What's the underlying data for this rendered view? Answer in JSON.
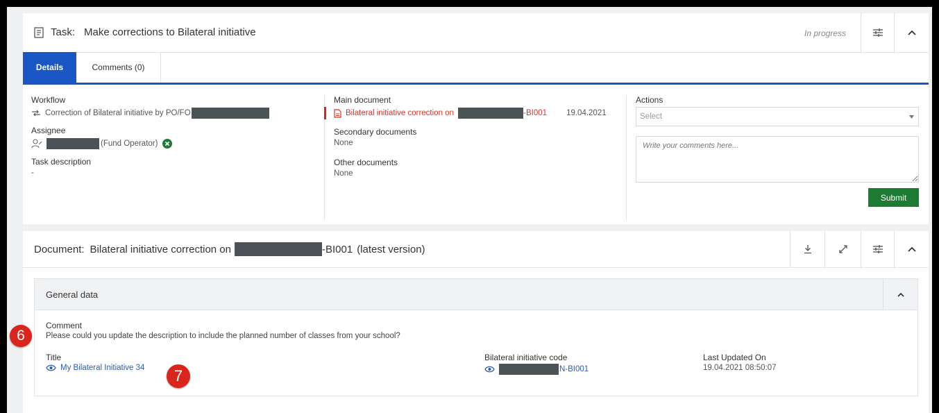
{
  "task": {
    "prefix": "Task:",
    "title": "Make corrections to Bilateral initiative",
    "status": "In progress",
    "tabs": [
      {
        "label": "Details",
        "active": true
      },
      {
        "label": "Comments (0)",
        "active": false
      }
    ],
    "workflow": {
      "label": "Workflow",
      "value": "Correction of Bilateral initiative by PO/FO"
    },
    "assignee": {
      "label": "Assignee",
      "role": "(Fund Operator)"
    },
    "task_description": {
      "label": "Task description",
      "value": "-"
    },
    "main_document": {
      "label": "Main document",
      "link_prefix": "Bilateral initiative correction on",
      "link_suffix": "-BI001",
      "date": "19.04.2021"
    },
    "secondary_documents": {
      "label": "Secondary documents",
      "value": "None"
    },
    "other_documents": {
      "label": "Other documents",
      "value": "None"
    },
    "actions": {
      "label": "Actions",
      "select_placeholder": "Select",
      "comment_placeholder": "Write your comments here...",
      "submit_label": "Submit"
    }
  },
  "document": {
    "prefix": "Document:",
    "title_start": "Bilateral initiative correction on",
    "title_end": "-BI001",
    "version": "(latest version)",
    "general_data": {
      "title": "General data",
      "comment_label": "Comment",
      "comment_value": "Please could you update the description to include the planned number of classes from your school?",
      "title_label": "Title",
      "title_value": "My Bilateral Initiative 34",
      "code_label": "Bilateral initiative code",
      "code_suffix": "N-BI001",
      "updated_label": "Last Updated On",
      "updated_value": "19.04.2021 08:50:07"
    }
  },
  "annotations": [
    "6",
    "7"
  ],
  "colors": {
    "accent": "#1a56c4",
    "submit": "#1e7b34",
    "annotation": "#d9251c",
    "link": "#2d5bb5",
    "document_red": "#d0352b"
  }
}
